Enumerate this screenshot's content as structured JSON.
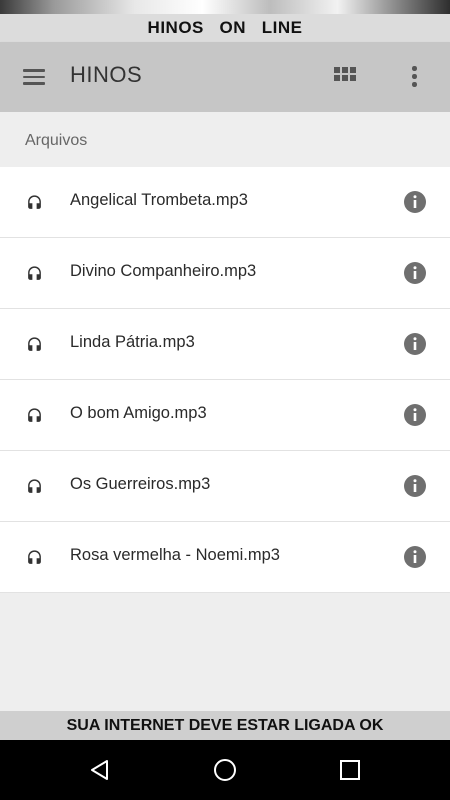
{
  "top_banner": {
    "text": "HINOS   ON   LINE"
  },
  "toolbar": {
    "title": "HINOS",
    "menu_icon": "hamburger-menu-icon",
    "grid_icon": "grid-view-icon",
    "more_icon": "more-vert-icon"
  },
  "section": {
    "title": "Arquivos"
  },
  "files": [
    {
      "name": "Angelical Trombeta.mp3",
      "icon": "headphones-icon",
      "action_icon": "info-icon"
    },
    {
      "name": "Divino Companheiro.mp3",
      "icon": "headphones-icon",
      "action_icon": "info-icon"
    },
    {
      "name": "Linda Pátria.mp3",
      "icon": "headphones-icon",
      "action_icon": "info-icon"
    },
    {
      "name": "O bom Amigo.mp3",
      "icon": "headphones-icon",
      "action_icon": "info-icon"
    },
    {
      "name": "Os Guerreiros.mp3",
      "icon": "headphones-icon",
      "action_icon": "info-icon"
    },
    {
      "name": "Rosa vermelha - Noemi.mp3",
      "icon": "headphones-icon",
      "action_icon": "info-icon"
    }
  ],
  "bottom_banner": {
    "text": "SUA INTERNET DEVE ESTAR LIGADA OK"
  },
  "navbar": {
    "back_icon": "back-triangle-icon",
    "home_icon": "home-circle-icon",
    "recent_icon": "recent-apps-icon"
  },
  "colors": {
    "toolbar_bg": "#c6c6c6",
    "banner_bg": "#dcdcdc",
    "list_bg": "#ffffff",
    "page_bg": "#eeeeee",
    "icon_gray": "#666666",
    "navbar_bg": "#000000"
  }
}
